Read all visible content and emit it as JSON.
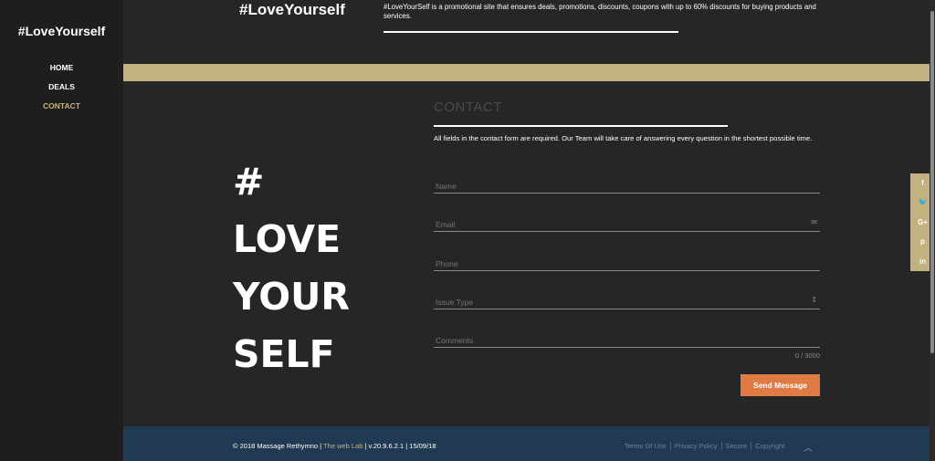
{
  "sidebar": {
    "logo": "#LoveYourself",
    "items": [
      {
        "label": "HOME"
      },
      {
        "label": "DEALS"
      },
      {
        "label": "CONTACT"
      }
    ]
  },
  "header": {
    "title": "#LoveYourself",
    "description": "#LoveYourSelf is a promotional site that ensures deals, promotions, discounts, coupons with up to 60% discounts for buying products and services."
  },
  "hero": {
    "line1": "#",
    "line2": "LOVE",
    "line3": "YOUR",
    "line4": "SELF"
  },
  "contact": {
    "title": "CONTACT",
    "description": "All fields in the contact form are required. Our Team will take care of answering every question in the shortest possible time.",
    "name_placeholder": "Name",
    "email_placeholder": "Email",
    "phone_placeholder": "Phone",
    "issue_placeholder": "Issue Type",
    "comments_placeholder": "Comments",
    "counter": "0 / 3000",
    "send_label": "Send Message"
  },
  "footer": {
    "copyright": "© 2018 Massage Rethymno | ",
    "weblab": "The web Lab",
    "version": " | v.20.9.6.2.1 | 15/09/18",
    "links": [
      "Terms Of Use",
      "Privacy Policy",
      "Secure",
      "Copyright"
    ],
    "up_icon": "^"
  },
  "social": [
    "f",
    "t",
    "G+",
    "p",
    "in"
  ],
  "colors": {
    "accent_gold": "#c3b17f",
    "send_button": "#e07b45",
    "footer_bg": "#1f3a52"
  }
}
